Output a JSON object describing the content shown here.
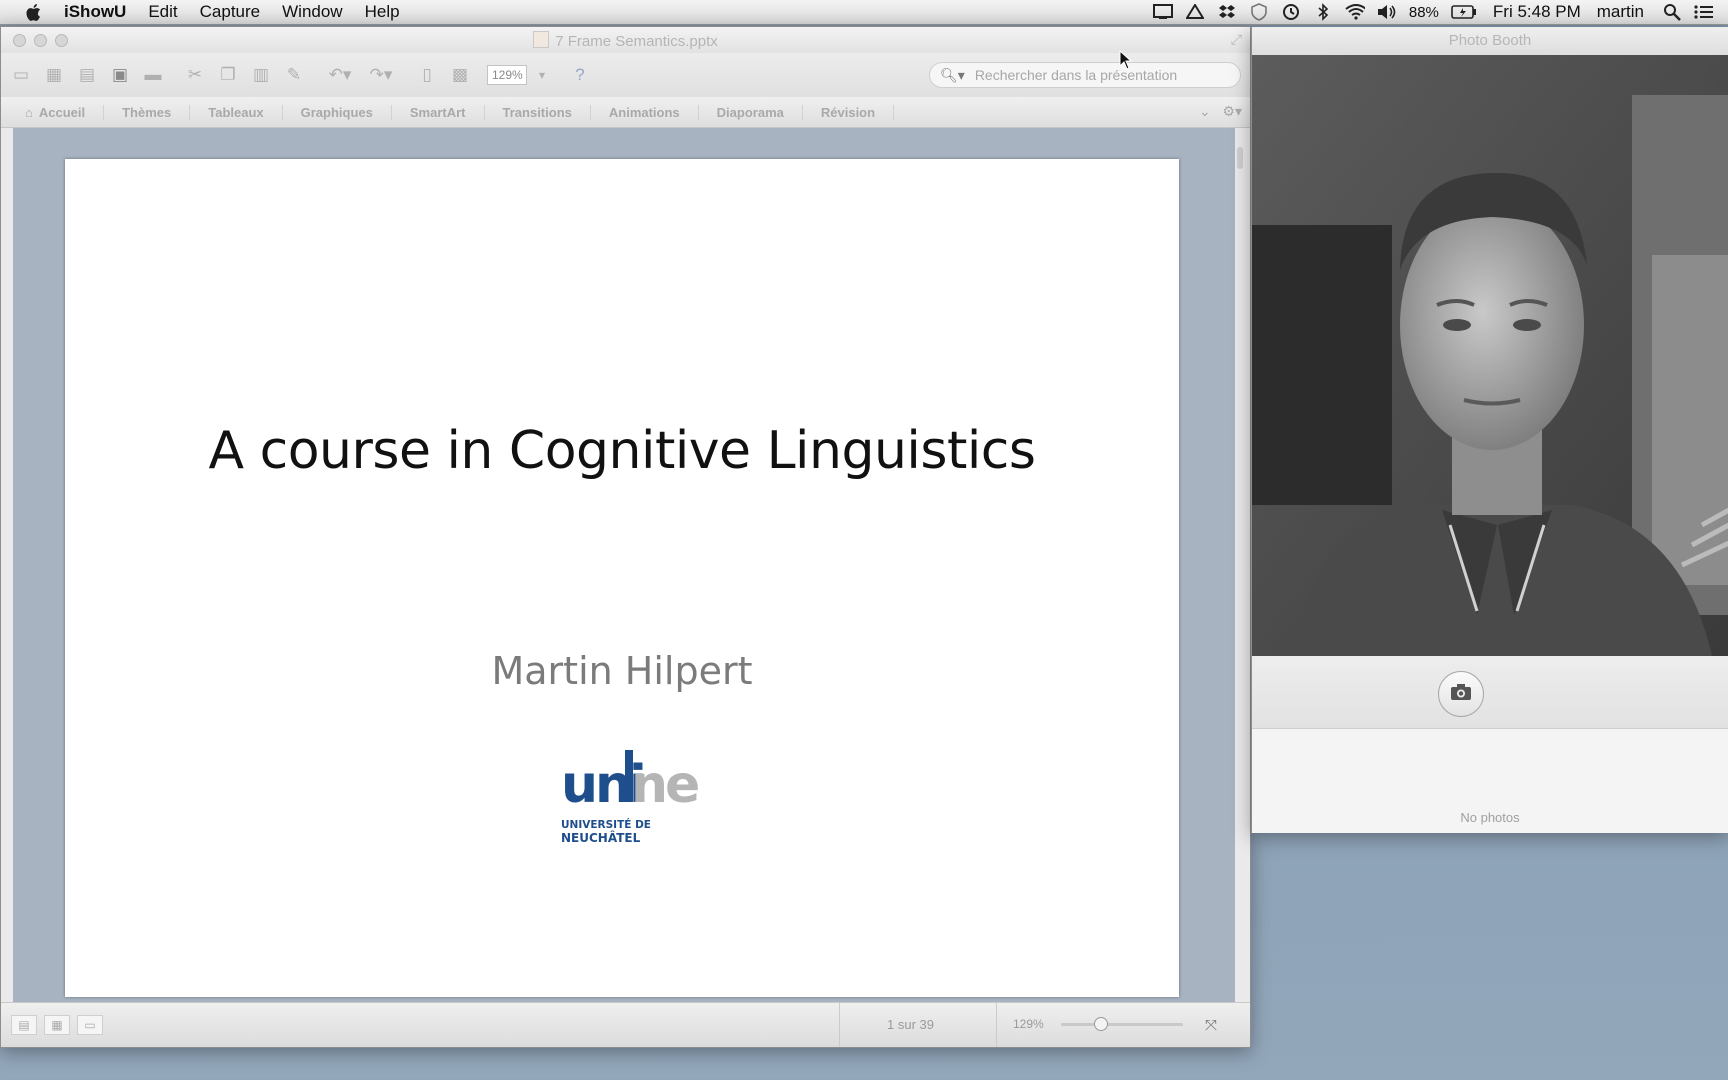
{
  "menubar": {
    "app_name": "iShowU",
    "items": [
      "Edit",
      "Capture",
      "Window",
      "Help"
    ],
    "battery_text": "88%",
    "clock": "Fri 5:48 PM",
    "user": "martin",
    "status_icons": [
      "display-icon",
      "drive-icon",
      "dropbox-icon",
      "shield-icon",
      "time-machine-icon",
      "bluetooth-icon",
      "wifi-icon",
      "volume-icon",
      "battery-icon",
      "spotlight-icon",
      "list-icon"
    ]
  },
  "ppt": {
    "title": "7 Frame Semantics.pptx",
    "zoom": "129%",
    "search_placeholder": "Rechercher dans la présentation",
    "ribbon_tabs": [
      "Accueil",
      "Thèmes",
      "Tableaux",
      "Graphiques",
      "SmartArt",
      "Transitions",
      "Animations",
      "Diaporama",
      "Révision"
    ],
    "slide": {
      "title": "A course in Cognitive Linguistics",
      "author": "Martin Hilpert",
      "logo_text": "unine",
      "logo_line1": "UNIVERSITÉ DE",
      "logo_line2": "NEUCHÂTEL"
    },
    "status": {
      "slide_count": "1 sur 39",
      "zoom": "129%"
    }
  },
  "photobooth": {
    "title": "Photo Booth",
    "empty_text": "No photos"
  },
  "colors": {
    "logo_blue": "#1f4e8c",
    "logo_grey": "#b5b5b5",
    "desktop": "#8aa0b5"
  }
}
